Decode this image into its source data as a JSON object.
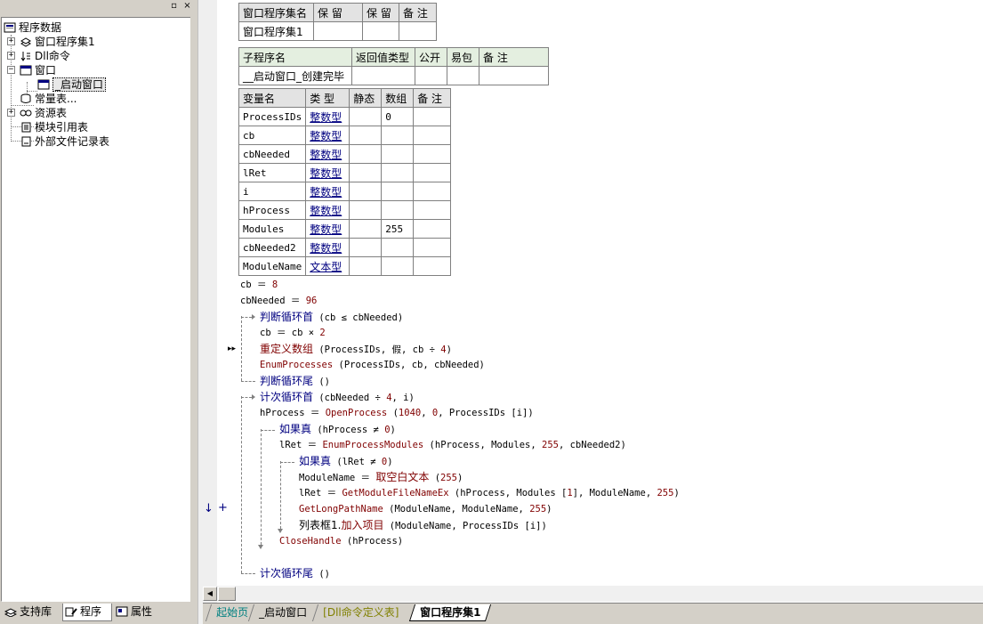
{
  "tree": {
    "root": "程序数据",
    "items": [
      {
        "label": "窗口程序集1",
        "expander": "+"
      },
      {
        "label": "Dll命令",
        "expander": "+"
      },
      {
        "label": "窗口",
        "expander": "−"
      },
      {
        "label": "_启动窗口"
      },
      {
        "label": "常量表..."
      },
      {
        "label": "资源表",
        "expander": "+"
      },
      {
        "label": "模块引用表"
      },
      {
        "label": "外部文件记录表"
      }
    ],
    "controls": {
      "restore": "▫",
      "close": "×"
    }
  },
  "left_tabs": [
    {
      "label": "支持库",
      "icon": "library-icon"
    },
    {
      "label": "程序",
      "icon": "program-icon"
    },
    {
      "label": "属性",
      "icon": "property-icon"
    }
  ],
  "assembly_table": {
    "headers": [
      "窗口程序集名",
      "保 留",
      "保 留",
      "备 注"
    ],
    "row": [
      "窗口程序集1",
      "",
      "",
      ""
    ]
  },
  "sub_table": {
    "headers": [
      "子程序名",
      "返回值类型",
      "公开",
      "易包",
      "备 注"
    ],
    "row": [
      "__启动窗口_创建完毕",
      "",
      "",
      "",
      ""
    ]
  },
  "var_table": {
    "headers": [
      "变量名",
      "类 型",
      "静态",
      "数组",
      "备 注"
    ],
    "rows": [
      [
        "ProcessIDs",
        "整数型",
        "",
        "0",
        ""
      ],
      [
        "cb",
        "整数型",
        "",
        "",
        ""
      ],
      [
        "cbNeeded",
        "整数型",
        "",
        "",
        ""
      ],
      [
        "lRet",
        "整数型",
        "",
        "",
        ""
      ],
      [
        "i",
        "整数型",
        "",
        "",
        ""
      ],
      [
        "hProcess",
        "整数型",
        "",
        "",
        ""
      ],
      [
        "Modules",
        "整数型",
        "",
        "255",
        ""
      ],
      [
        "cbNeeded2",
        "整数型",
        "",
        "",
        ""
      ],
      [
        "ModuleName",
        "文本型",
        "",
        "",
        ""
      ]
    ]
  },
  "code": {
    "l1": {
      "a": "cb",
      "b": " ＝ ",
      "c": "8"
    },
    "l2": {
      "a": "cbNeeded",
      "b": " ＝ ",
      "c": "96"
    },
    "l3": {
      "kw": "判断循环首",
      "rest": " (cb ≤ cbNeeded)"
    },
    "l4": {
      "a": "cb ＝ cb × ",
      "c": "2"
    },
    "l5": {
      "fn": "重定义数组",
      "rest": " (ProcessIDs, 假, cb ÷ ",
      "c": "4",
      "end": ")"
    },
    "l6": {
      "fn": "EnumProcesses",
      "rest": " (ProcessIDs, cb, cbNeeded)"
    },
    "l7": {
      "kw": "判断循环尾",
      "rest": " ()"
    },
    "l8": {
      "kw": "计次循环首",
      "rest": " (cbNeeded ÷ ",
      "c": "4",
      "end": ", i)"
    },
    "l9": {
      "a": "hProcess ＝ ",
      "fn": "OpenProcess",
      "rest": " (",
      "c": "1040",
      "mid": ", ",
      "c2": "0",
      "end": ", ProcessIDs [i])"
    },
    "l10": {
      "kw": "如果真",
      "rest": " (hProcess ≠ ",
      "c": "0",
      "end": ")"
    },
    "l11": {
      "a": "lRet ＝ ",
      "fn": "EnumProcessModules",
      "rest": " (hProcess, Modules, ",
      "c": "255",
      "end": ", cbNeeded2)"
    },
    "l12": {
      "kw": "如果真",
      "rest": " (lRet ≠ ",
      "c": "0",
      "end": ")"
    },
    "l13": {
      "a": "ModuleName ＝ ",
      "fn": "取空白文本",
      "rest": " (",
      "c": "255",
      "end": ")"
    },
    "l14": {
      "a": "lRet ＝ ",
      "fn": "GetModuleFileNameEx",
      "rest": " (hProcess, Modules [",
      "c": "1",
      "mid": "], ModuleName, ",
      "c2": "255",
      "end": ")"
    },
    "l15": {
      "fn": "GetLongPathName",
      "rest": " (ModuleName, ModuleName, ",
      "c": "255",
      "end": ")"
    },
    "l16": {
      "obj": "列表框1.",
      "fn": "加入项目",
      "rest": " (ModuleName, ProcessIDs [i])"
    },
    "l17": {
      "fn": "CloseHandle",
      "rest": " (hProcess)"
    },
    "l18": {
      "kw": "计次循环尾",
      "rest": " ()"
    }
  },
  "gutter": {
    "arrow": "▸▸",
    "down": "↓",
    "plus": "+"
  },
  "doc_tabs": [
    {
      "label": "起始页"
    },
    {
      "label": "_启动窗口"
    },
    {
      "label": "[Dll命令定义表]"
    },
    {
      "label": "窗口程序集1"
    }
  ],
  "colors": {
    "keyword": "#000080",
    "function": "#800000",
    "number": "#800000",
    "dll_tab": "#808000",
    "start_tab": "#008080"
  }
}
